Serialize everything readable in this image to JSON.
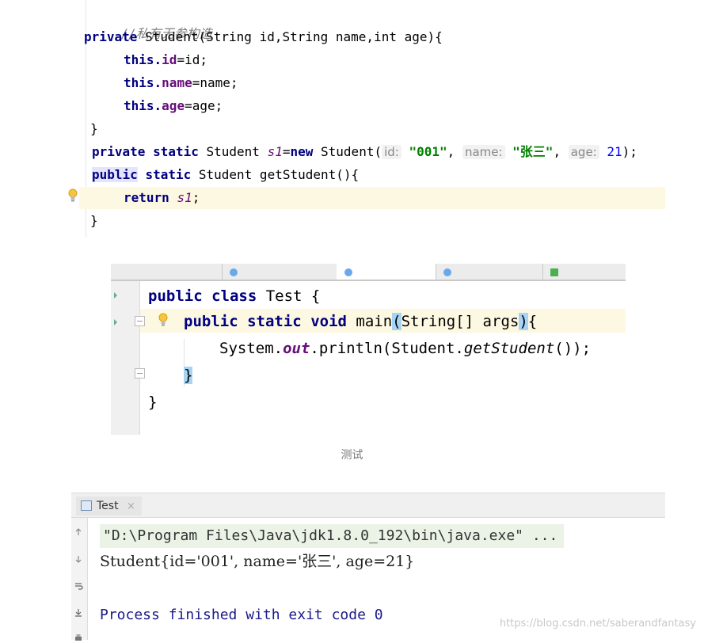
{
  "panel1": {
    "comment": "//私有无参构造",
    "ctor": {
      "kw": "private",
      "rest": " Student(String id,String name,int age){",
      "int_kw": "int"
    },
    "assign": [
      {
        "this": "this.",
        "field": "id",
        "val": "=id;"
      },
      {
        "this": "this.",
        "field": "name",
        "val": "=name;"
      },
      {
        "this": "this.",
        "field": "age",
        "val": "=age;"
      }
    ],
    "close1": "}",
    "field_line": {
      "kw1": "private",
      "kw2": "static",
      "type": " Student ",
      "var": "s1",
      "eq": "=",
      "new": "new",
      "call": " Student(",
      "hint_id": "id:",
      "v_id": "\"001\"",
      "comma1": ",",
      "hint_name": "name:",
      "v_name": "\"张三\"",
      "comma2": ",",
      "hint_age": "age:",
      "v_age": "21",
      "end": ");"
    },
    "method_line": {
      "kw1": "public",
      "kw2": "static",
      "rest": " Student getStudent(){"
    },
    "return_line": {
      "kw": "return",
      "var": "s1",
      "semi": ";"
    },
    "close2": "}"
  },
  "panel2": {
    "class_line": {
      "kw1": "public",
      "kw2": "class",
      "rest": " Test {"
    },
    "main_line": {
      "kw1": "public",
      "kw2": "static",
      "kw3": "void",
      "name": " main",
      "lp": "(",
      "args": "String[] args",
      "rp": ")",
      "lb": "{"
    },
    "print_line": {
      "sys": "System.",
      "out": "out",
      "mid": ".println(Student.",
      "get": "getStudent",
      "end": "());"
    },
    "rb_inner": "}",
    "rb_outer": "}"
  },
  "caption": "测试",
  "panel3": {
    "tab_label": "Test",
    "tab_close": "×",
    "cmd": "\"D:\\Program Files\\Java\\jdk1.8.0_192\\bin\\java.exe\" ...",
    "output": "Student{id='001', name='张三', age=21}",
    "exit": "Process finished with exit code 0"
  },
  "watermark": "https://blog.csdn.net/saberandfantasy",
  "colors": {
    "keyword": "#000080",
    "field": "#660e7a",
    "string": "#008000",
    "number": "#0000ff",
    "comment": "#808080",
    "caret_row": "#fdf8e1",
    "brace_match": "#a7d3f5"
  }
}
